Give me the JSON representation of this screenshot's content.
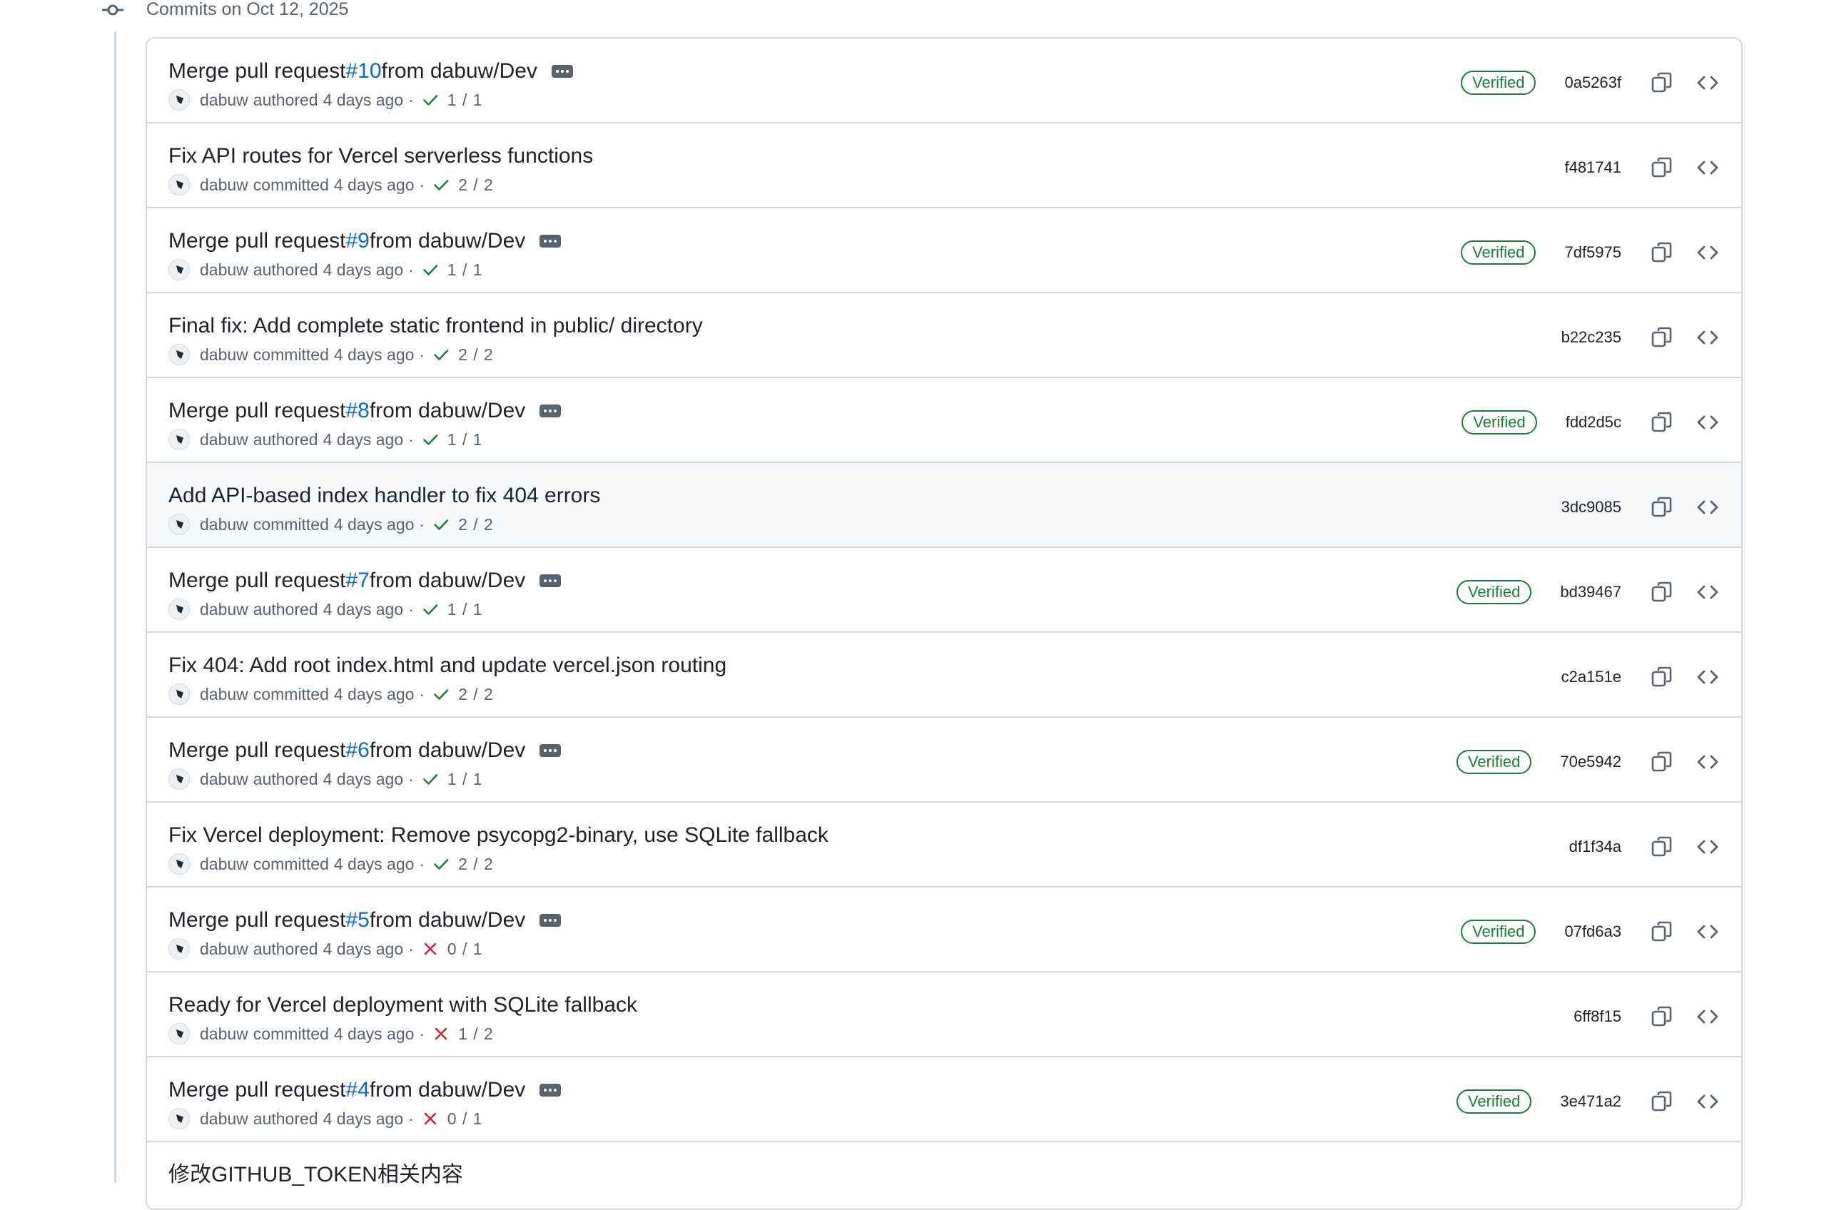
{
  "group": {
    "title": "Commits on Oct 12, 2025"
  },
  "colors": {
    "link": "#0969da",
    "verified": "#1a7f37",
    "success": "#1a7f37",
    "failure": "#d1242f",
    "muted": "#59636e"
  },
  "commits": [
    {
      "title_before": "Merge pull request ",
      "pr": "#10",
      "title_after": " from dabuw/Dev",
      "has_ellipsis": true,
      "author": "dabuw",
      "verb": "authored",
      "time": "4 days ago",
      "sep": "·",
      "status": "success",
      "checks": "1 / 1",
      "verified": "Verified",
      "sha": "0a5263f"
    },
    {
      "title_before": "Fix API routes for Vercel serverless functions",
      "pr": "",
      "title_after": "",
      "has_ellipsis": false,
      "author": "dabuw",
      "verb": "committed",
      "time": "4 days ago",
      "sep": "·",
      "status": "success",
      "checks": "2 / 2",
      "verified": "",
      "sha": "f481741"
    },
    {
      "title_before": "Merge pull request ",
      "pr": "#9",
      "title_after": " from dabuw/Dev",
      "has_ellipsis": true,
      "author": "dabuw",
      "verb": "authored",
      "time": "4 days ago",
      "sep": "·",
      "status": "success",
      "checks": "1 / 1",
      "verified": "Verified",
      "sha": "7df5975"
    },
    {
      "title_before": "Final fix: Add complete static frontend in public/ directory",
      "pr": "",
      "title_after": "",
      "has_ellipsis": false,
      "author": "dabuw",
      "verb": "committed",
      "time": "4 days ago",
      "sep": "·",
      "status": "success",
      "checks": "2 / 2",
      "verified": "",
      "sha": "b22c235"
    },
    {
      "title_before": "Merge pull request ",
      "pr": "#8",
      "title_after": " from dabuw/Dev",
      "has_ellipsis": true,
      "author": "dabuw",
      "verb": "authored",
      "time": "4 days ago",
      "sep": "·",
      "status": "success",
      "checks": "1 / 1",
      "verified": "Verified",
      "sha": "fdd2d5c"
    },
    {
      "title_before": "Add API-based index handler to fix 404 errors",
      "pr": "",
      "title_after": "",
      "has_ellipsis": false,
      "author": "dabuw",
      "verb": "committed",
      "time": "4 days ago",
      "sep": "·",
      "status": "success",
      "checks": "2 / 2",
      "verified": "",
      "sha": "3dc9085",
      "hovered": true
    },
    {
      "title_before": "Merge pull request ",
      "pr": "#7",
      "title_after": " from dabuw/Dev",
      "has_ellipsis": true,
      "author": "dabuw",
      "verb": "authored",
      "time": "4 days ago",
      "sep": "·",
      "status": "success",
      "checks": "1 / 1",
      "verified": "Verified",
      "sha": "bd39467"
    },
    {
      "title_before": "Fix 404: Add root index.html and update vercel.json routing",
      "pr": "",
      "title_after": "",
      "has_ellipsis": false,
      "author": "dabuw",
      "verb": "committed",
      "time": "4 days ago",
      "sep": "·",
      "status": "success",
      "checks": "2 / 2",
      "verified": "",
      "sha": "c2a151e"
    },
    {
      "title_before": "Merge pull request ",
      "pr": "#6",
      "title_after": " from dabuw/Dev",
      "has_ellipsis": true,
      "author": "dabuw",
      "verb": "authored",
      "time": "4 days ago",
      "sep": "·",
      "status": "success",
      "checks": "1 / 1",
      "verified": "Verified",
      "sha": "70e5942"
    },
    {
      "title_before": "Fix Vercel deployment: Remove psycopg2-binary, use SQLite fallback",
      "pr": "",
      "title_after": "",
      "has_ellipsis": false,
      "author": "dabuw",
      "verb": "committed",
      "time": "4 days ago",
      "sep": "·",
      "status": "success",
      "checks": "2 / 2",
      "verified": "",
      "sha": "df1f34a"
    },
    {
      "title_before": "Merge pull request ",
      "pr": "#5",
      "title_after": " from dabuw/Dev",
      "has_ellipsis": true,
      "author": "dabuw",
      "verb": "authored",
      "time": "4 days ago",
      "sep": "·",
      "status": "failure",
      "checks": "0 / 1",
      "verified": "Verified",
      "sha": "07fd6a3"
    },
    {
      "title_before": "Ready for Vercel deployment with SQLite fallback",
      "pr": "",
      "title_after": "",
      "has_ellipsis": false,
      "author": "dabuw",
      "verb": "committed",
      "time": "4 days ago",
      "sep": "·",
      "status": "failure",
      "checks": "1 / 2",
      "verified": "",
      "sha": "6ff8f15"
    },
    {
      "title_before": "Merge pull request ",
      "pr": "#4",
      "title_after": " from dabuw/Dev",
      "has_ellipsis": true,
      "author": "dabuw",
      "verb": "authored",
      "time": "4 days ago",
      "sep": "·",
      "status": "failure",
      "checks": "0 / 1",
      "verified": "Verified",
      "sha": "3e471a2"
    },
    {
      "title_before": "修改GITHUB_TOKEN相关内容",
      "pr": "",
      "title_after": "",
      "has_ellipsis": false,
      "author": "",
      "verb": "",
      "time": "",
      "sep": "",
      "status": "",
      "checks": "",
      "verified": "",
      "sha": ""
    }
  ]
}
